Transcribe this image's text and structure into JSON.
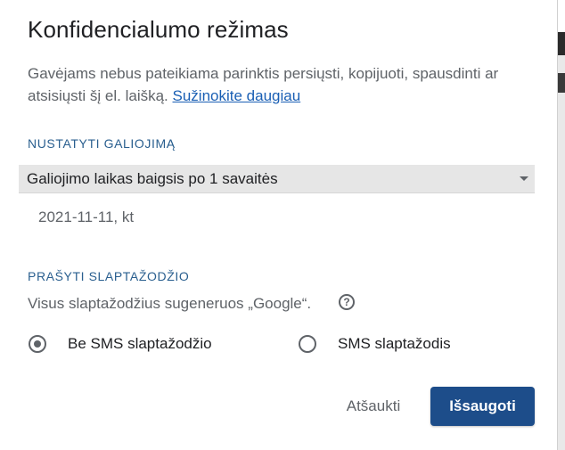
{
  "dialog": {
    "title": "Konfidencialumo režimas",
    "description": "Gavėjams nebus pateikiama parinktis persiųsti, kopijuoti, spausdinti ar atsisiųsti šį el. laišką.",
    "learn_more_link": "Sužinokite daugiau"
  },
  "expiry": {
    "section_label": "NUSTATYTI GALIOJIMĄ",
    "selected_option": "Galiojimo laikas baigsis po 1 savaitės",
    "dropdown_icon": "chevron-down-icon",
    "date": "2021-11-11, kt"
  },
  "password": {
    "section_label": "PRAŠYTI SLAPTAŽODŽIO",
    "description": "Visus slaptažodžius sugeneruos „Google“.",
    "help_icon": "help-icon",
    "help_glyph": "?",
    "options": [
      {
        "label": "Be SMS slaptažodžio",
        "selected": true
      },
      {
        "label": "SMS slaptažodis",
        "selected": false
      }
    ]
  },
  "actions": {
    "cancel_label": "Atšaukti",
    "save_label": "Išsaugoti"
  },
  "colors": {
    "primary_button": "#1d4d8a",
    "link": "#1a5fb4",
    "section_label": "#2a5f8f",
    "select_background": "#e6e6e6"
  }
}
